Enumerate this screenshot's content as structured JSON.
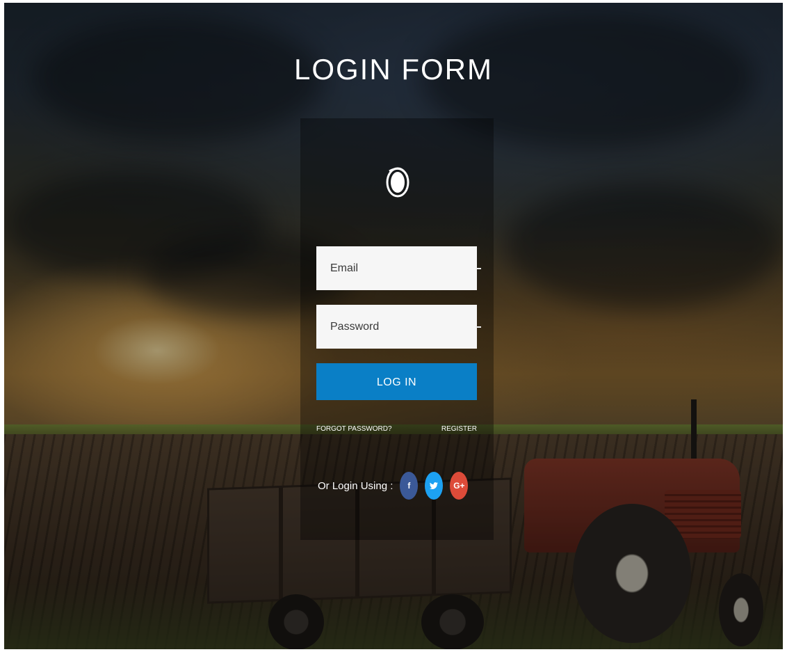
{
  "page": {
    "title": "LOGIN FORM"
  },
  "form": {
    "email_placeholder": "Email",
    "password_placeholder": "Password",
    "login_label": "LOG IN",
    "forgot_label": "FORGOT PASSWORD?",
    "register_label": "REGISTER",
    "social_label": "Or Login Using :",
    "social": [
      {
        "glyph": "f",
        "icon": "facebook-icon",
        "color": "#3b5998"
      },
      {
        "glyph": "t",
        "icon": "twitter-icon",
        "color": "#1da1f2"
      },
      {
        "glyph": "G+",
        "icon": "google-plus-icon",
        "color": "#dd4b39"
      }
    ]
  },
  "colors": {
    "primary": "#0a7fc6",
    "title_text": "#ffffff",
    "field_bg": "#f6f6f6"
  },
  "icons": {
    "logo": "logo-icon",
    "email": "user-icon",
    "password": "lock-icon",
    "autofill": "autofill-key-icon"
  }
}
